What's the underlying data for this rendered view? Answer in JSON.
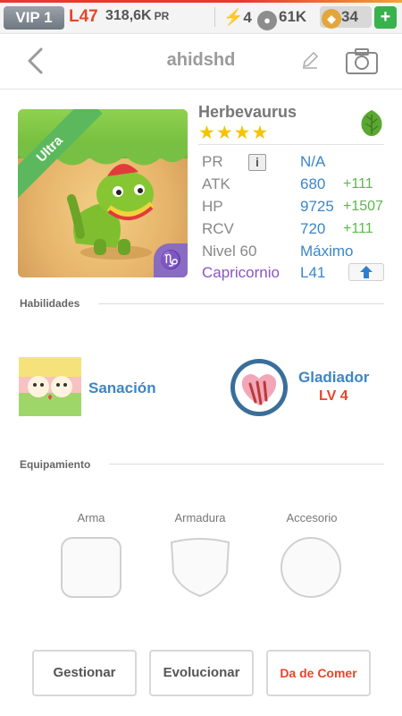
{
  "status_bar": {
    "vip": "VIP 1",
    "level": "L47",
    "pr_amount": "318,6K",
    "pr_suffix": "PR",
    "energy": "4",
    "paws": "61K",
    "coins": "34",
    "plus_label": "+"
  },
  "header": {
    "title": "ahidshd"
  },
  "monster": {
    "name": "Herbevaurus",
    "stars": "★★★★",
    "rarity_badge": "Ultra",
    "element_icon": "leaf-icon",
    "stats": {
      "pr_label": "PR",
      "pr_value": "N/A",
      "info_label": "i",
      "atk_label": "ATK",
      "atk_value": "680",
      "atk_bonus": "+111",
      "hp_label": "HP",
      "hp_value": "9725",
      "hp_bonus": "+1507",
      "rcv_label": "RCV",
      "rcv_value": "720",
      "rcv_bonus": "+111",
      "level_label": "Nivel 60",
      "level_value": "Máximo",
      "zodiac_label": "Capricornio",
      "zodiac_value": "L41"
    }
  },
  "skills": {
    "section_title": "Habilidades",
    "active_name": "Sanación",
    "leader_name": "Gladiador",
    "leader_level": "LV 4"
  },
  "equipment": {
    "section_title": "Equipamiento",
    "weapon_label": "Arma",
    "armor_label": "Armadura",
    "accessory_label": "Accesorio"
  },
  "actions": {
    "manage": "Gestionar",
    "evolve": "Evolucionar",
    "feed": "Da de Comer"
  }
}
